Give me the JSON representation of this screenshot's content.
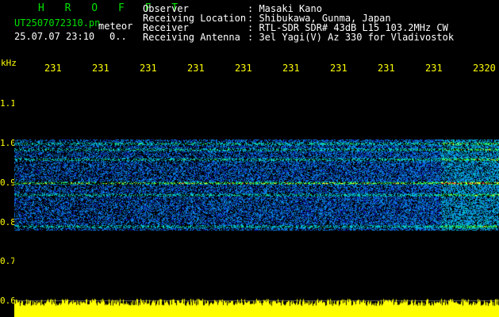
{
  "header": {
    "app_title": "H R O F F T",
    "filename": "UT2507072310.pn",
    "mode": "meteor",
    "datetime": "25.07.07 23:10",
    "counter": "0..",
    "fields": [
      {
        "label": "Observer",
        "value": ": Masaki Kano"
      },
      {
        "label": "Receiving Location",
        "value": ": Shibukawa, Gunma, Japan"
      },
      {
        "label": "Receiver",
        "value": ": RTL-SDR SDR# 43dB L15 103.2MHz CW"
      },
      {
        "label": "Receiving Antenna",
        "value": ": 3el Yagi(V) Az 330 for Vladivostok"
      }
    ]
  },
  "chart_data": {
    "type": "heatmap",
    "ylabel": "kHz",
    "y_ticks": [
      "1.1",
      "1.0",
      "0.9",
      "0.8",
      "0.7",
      "0.6"
    ],
    "ylim": [
      0.6,
      1.15
    ],
    "x_ticks": [
      "231",
      "231",
      "231",
      "231",
      "231",
      "231",
      "231",
      "231",
      "231",
      "2320"
    ],
    "signal_band": [
      0.78,
      1.01
    ],
    "lines_khz": [
      0.79,
      0.87,
      0.9,
      0.96,
      0.985,
      1.0
    ],
    "strong_line_khz": 0.9,
    "colors": {
      "bg": "#000000",
      "noise": "#1030c0",
      "mid": "#00d0e0",
      "high": "#40ff40",
      "peak": "#ff2060",
      "power": "#ffff00",
      "tick": "#ffff00"
    }
  }
}
